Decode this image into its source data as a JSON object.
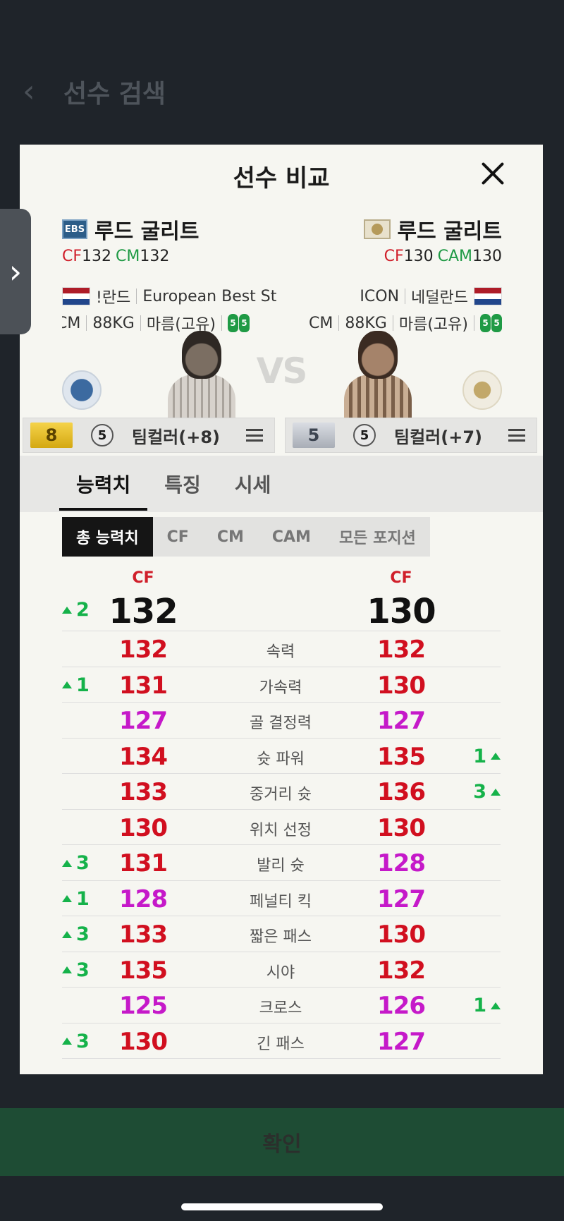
{
  "background": {
    "title": "선수 검색"
  },
  "modal": {
    "title": "선수 비교",
    "vs": "VS",
    "player_left": {
      "tag": "EBS",
      "name": "루드 굴리트",
      "pos1": "CF",
      "ovr1": "132",
      "pos2": "CM",
      "ovr2": "132",
      "country": "!란드",
      "league": "European Best St",
      "position": "CM",
      "weight": "88KG",
      "body": "마름(고유)",
      "foot_l": "5",
      "foot_r": "5",
      "grade": "8",
      "level": "5",
      "team_color": "팀컬러(+8)"
    },
    "player_right": {
      "tag": "ICON",
      "name": "루드 굴리트",
      "pos1": "CF",
      "ovr1": "130",
      "pos2": "CAM",
      "ovr2": "130",
      "league": "ICON",
      "country": "네덜란드",
      "position": "CM",
      "weight": "88KG",
      "body": "마름(고유)",
      "foot_l": "5",
      "foot_r": "5",
      "grade": "5",
      "level": "5",
      "team_color": "팀컬러(+7)"
    },
    "tabs": [
      "능력치",
      "특징",
      "시세"
    ],
    "subtabs": [
      "총 능력치",
      "CF",
      "CM",
      "CAM",
      "모든 포지션"
    ],
    "overall": {
      "left_pos": "CF",
      "left_val": "132",
      "right_pos": "CF",
      "right_val": "130",
      "left_diff": "2",
      "right_diff": ""
    },
    "stats": [
      {
        "name": "속력",
        "left": "132",
        "right": "132",
        "left_diff": "",
        "right_diff": "",
        "left_color": "red",
        "right_color": "red"
      },
      {
        "name": "가속력",
        "left": "131",
        "right": "130",
        "left_diff": "1",
        "right_diff": "",
        "left_color": "red",
        "right_color": "red"
      },
      {
        "name": "골 결정력",
        "left": "127",
        "right": "127",
        "left_diff": "",
        "right_diff": "",
        "left_color": "mag",
        "right_color": "mag"
      },
      {
        "name": "슛 파워",
        "left": "134",
        "right": "135",
        "left_diff": "",
        "right_diff": "1",
        "left_color": "red",
        "right_color": "red"
      },
      {
        "name": "중거리 슛",
        "left": "133",
        "right": "136",
        "left_diff": "",
        "right_diff": "3",
        "left_color": "red",
        "right_color": "red"
      },
      {
        "name": "위치 선정",
        "left": "130",
        "right": "130",
        "left_diff": "",
        "right_diff": "",
        "left_color": "red",
        "right_color": "red"
      },
      {
        "name": "발리 슛",
        "left": "131",
        "right": "128",
        "left_diff": "3",
        "right_diff": "",
        "left_color": "red",
        "right_color": "mag"
      },
      {
        "name": "페널티 킥",
        "left": "128",
        "right": "127",
        "left_diff": "1",
        "right_diff": "",
        "left_color": "mag",
        "right_color": "mag"
      },
      {
        "name": "짧은 패스",
        "left": "133",
        "right": "130",
        "left_diff": "3",
        "right_diff": "",
        "left_color": "red",
        "right_color": "red"
      },
      {
        "name": "시야",
        "left": "135",
        "right": "132",
        "left_diff": "3",
        "right_diff": "",
        "left_color": "red",
        "right_color": "red"
      },
      {
        "name": "크로스",
        "left": "125",
        "right": "126",
        "left_diff": "",
        "right_diff": "1",
        "left_color": "mag",
        "right_color": "mag"
      },
      {
        "name": "긴 패스",
        "left": "130",
        "right": "127",
        "left_diff": "3",
        "right_diff": "",
        "left_color": "red",
        "right_color": "mag"
      }
    ]
  },
  "confirm_label": "확인",
  "colors": {
    "stat_red": "#d10f1f",
    "stat_magenta": "#c519c9",
    "increase_green": "#15b24a",
    "confirm_bg": "#1e4c34"
  }
}
